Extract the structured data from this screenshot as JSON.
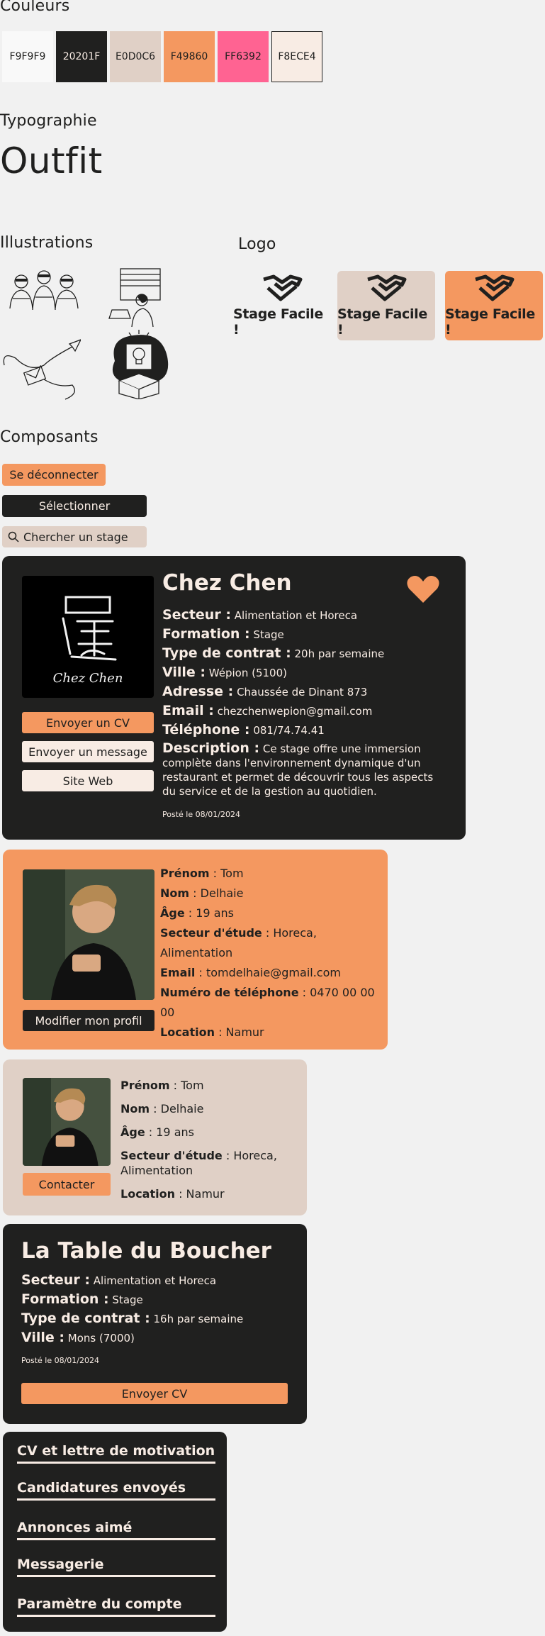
{
  "sections": {
    "colors": "Couleurs",
    "typography": "Typographie",
    "illustrations": "Illustrations",
    "logo": "Logo",
    "components": "Composants"
  },
  "swatches": [
    {
      "label": "F9F9F9",
      "color": "#F9F9F9"
    },
    {
      "label": "20201F",
      "color": "#20201F"
    },
    {
      "label": "E0D0C6",
      "color": "#E0D0C6"
    },
    {
      "label": "F49860",
      "color": "#F49860"
    },
    {
      "label": "FF6392",
      "color": "#FF6392"
    },
    {
      "label": "F8ECE4",
      "color": "#F8ECE4"
    }
  ],
  "font_sample": "Outfit",
  "logos": [
    {
      "text": "Stage Facile !",
      "bg": "transparent"
    },
    {
      "text": "Stage Facile !",
      "bg": "#E0D0C6"
    },
    {
      "text": "Stage Facile !",
      "bg": "#F49860"
    }
  ],
  "buttons": {
    "logout": "Se déconnecter",
    "select": "Sélectionner"
  },
  "search": {
    "placeholder": "Chercher un stage"
  },
  "offer_card": {
    "logo_text": "Chez Chen",
    "title": "Chez Chen",
    "sector_label": "Secteur :",
    "sector": "Alimentation et Horeca",
    "training_label": "Formation :",
    "training": "Stage",
    "contract_label": "Type de contrat :",
    "contract": "20h par semaine",
    "city_label": "Ville :",
    "city": "Wépion (5100)",
    "address_label": "Adresse :",
    "address": "Chaussée de Dinant 873",
    "email_label": "Email :",
    "email": "chezchenwepion@gmail.com",
    "phone_label": "Téléphone :",
    "phone": "081/74.74.41",
    "description_label": "Description :",
    "description": "Ce stage offre une immersion complète dans l'environnement dynamique d'un restaurant et permet de découvrir tous les aspects du service et de la gestion au quotidien.",
    "posted": "Posté le 08/01/2024",
    "btn_cv": "Envoyer un CV",
    "btn_message": "Envoyer un message",
    "btn_site": "Site Web"
  },
  "profile_card": {
    "firstname_label": "Prénom",
    "firstname": "Tom",
    "lastname_label": "Nom",
    "lastname": "Delhaie",
    "age_label": "Âge",
    "age": "19 ans",
    "study_label": "Secteur d'étude",
    "study": "Horeca, Alimentation",
    "email_label": "Email",
    "email": "tomdelhaie@gmail.com",
    "phone_label": "Numéro de téléphone",
    "phone": "0470 00 00 00",
    "location_label": "Location",
    "location": "Namur",
    "btn_edit": "Modifier mon profil"
  },
  "mini_profile": {
    "firstname_label": "Prénom",
    "firstname": "Tom",
    "lastname_label": "Nom",
    "lastname": "Delhaie",
    "age_label": "Âge",
    "age": "19 ans",
    "study_label": "Secteur d'étude",
    "study": "Horeca, Alimentation",
    "location_label": "Location",
    "location": "Namur",
    "btn_contact": "Contacter"
  },
  "small_offer": {
    "title": "La Table du Boucher",
    "sector_label": "Secteur :",
    "sector": "Alimentation et Horeca",
    "training_label": "Formation :",
    "training": "Stage",
    "contract_label": "Type de contrat :",
    "contract": "16h par semaine",
    "city_label": "Ville :",
    "city": "Mons (7000)",
    "posted": "Posté le 08/01/2024",
    "btn_cv": "Envoyer CV"
  },
  "menu": [
    "CV et lettre de motivation",
    "Candidatures envoyés",
    "Annonces aimé",
    "Messagerie",
    "Paramètre du compte"
  ]
}
